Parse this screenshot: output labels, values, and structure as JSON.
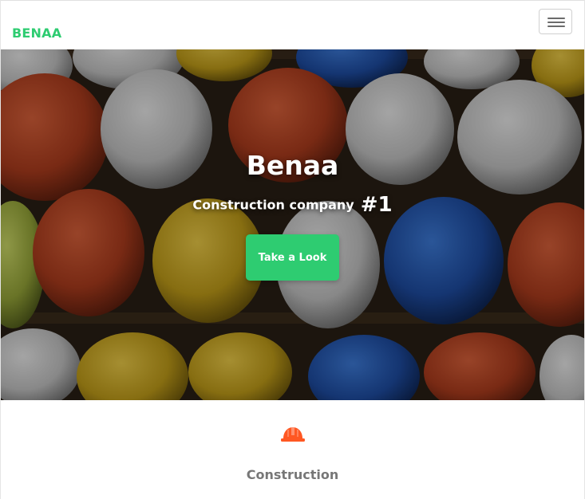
{
  "navbar": {
    "brand": "BENAA",
    "toggle_icon": "hamburger-menu-icon",
    "brand_color": "#2ecc71"
  },
  "hero": {
    "title": "Benaa",
    "subtitle": "Construction company",
    "rank": "#1",
    "cta_label": "Take a Look",
    "cta_color": "#2ecc71",
    "background": "hard-hats-photo"
  },
  "services": {
    "icon": "hard-hat-icon",
    "icon_color": "#ff5722",
    "title": "Construction"
  }
}
